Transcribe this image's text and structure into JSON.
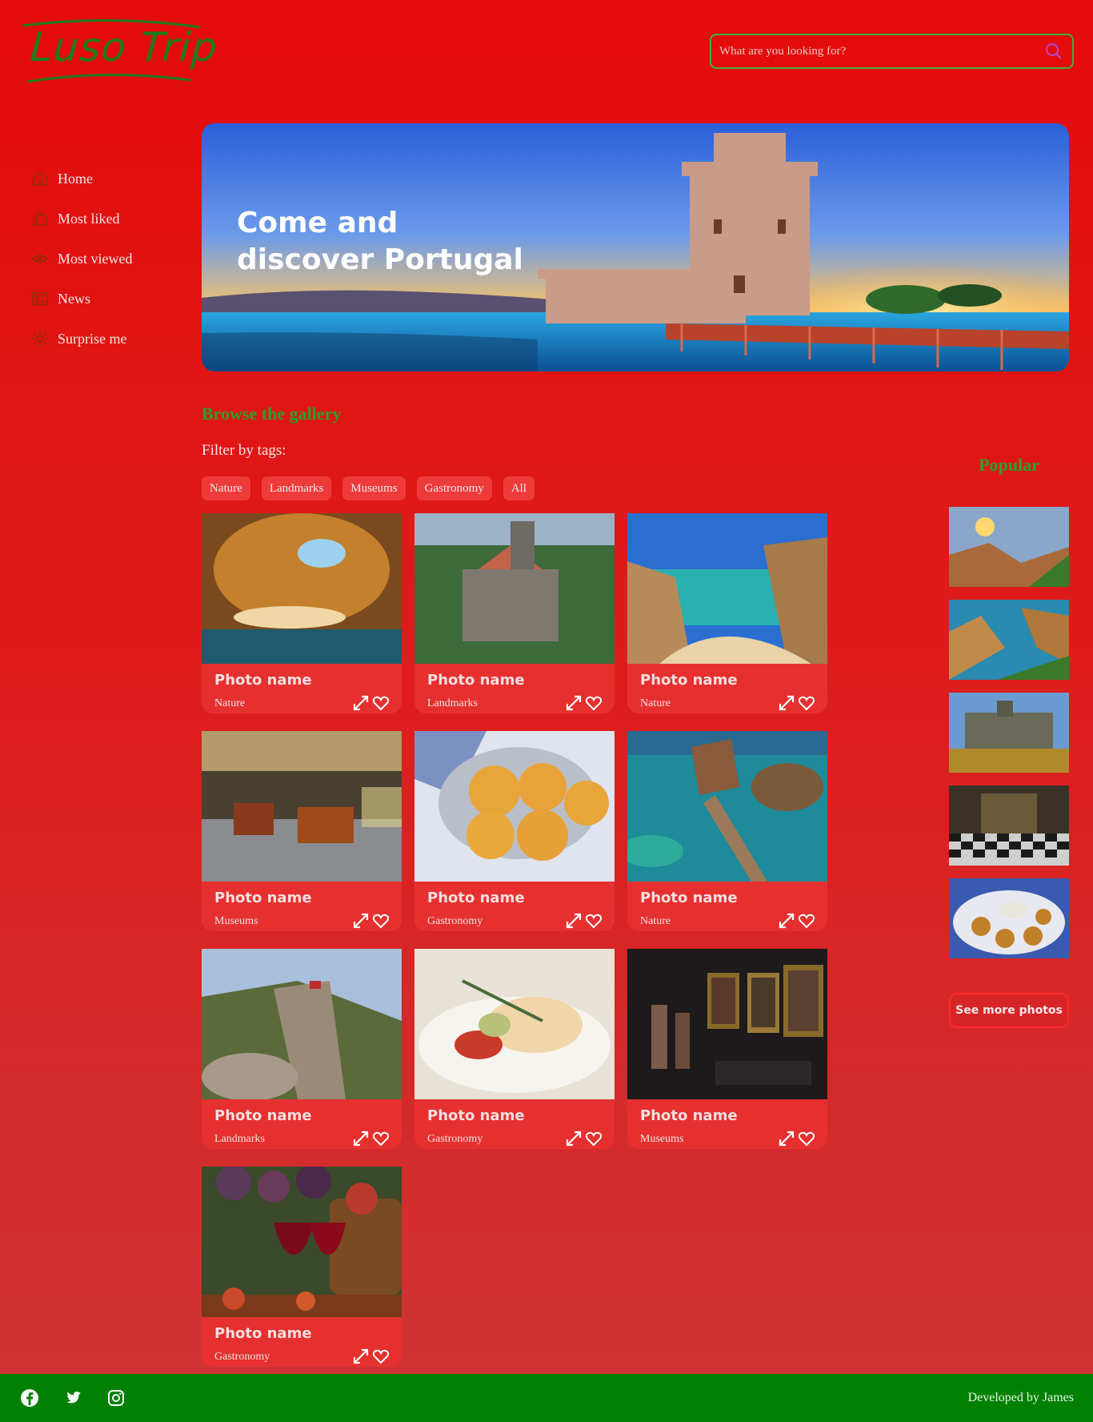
{
  "brand": {
    "logo_text": "Luso Trip",
    "accent_green": "#2aa02a",
    "footer_green": "#008000",
    "background_red": "#e40b0b"
  },
  "search": {
    "placeholder": "What are you looking for?",
    "icon": "search-icon"
  },
  "nav": [
    {
      "label": "Home",
      "icon": "home-icon"
    },
    {
      "label": "Most liked",
      "icon": "thumbs-up-icon"
    },
    {
      "label": "Most viewed",
      "icon": "eye-icon"
    },
    {
      "label": "News",
      "icon": "newspaper-icon"
    },
    {
      "label": "Surprise me",
      "icon": "sun-icon"
    }
  ],
  "hero": {
    "title": "Come and discover Portugal"
  },
  "gallery": {
    "title": "Browse the gallery",
    "filter_label": "Filter by tags:",
    "tags": [
      "Nature",
      "Landmarks",
      "Museums",
      "Gastronomy",
      "All"
    ],
    "cards": [
      {
        "name": "Photo name",
        "tag": "Nature"
      },
      {
        "name": "Photo name",
        "tag": "Landmarks"
      },
      {
        "name": "Photo name",
        "tag": "Nature"
      },
      {
        "name": "Photo name",
        "tag": "Museums"
      },
      {
        "name": "Photo name",
        "tag": "Gastronomy"
      },
      {
        "name": "Photo name",
        "tag": "Nature"
      },
      {
        "name": "Photo name",
        "tag": "Landmarks"
      },
      {
        "name": "Photo name",
        "tag": "Gastronomy"
      },
      {
        "name": "Photo name",
        "tag": "Museums"
      },
      {
        "name": "Photo name",
        "tag": "Gastronomy"
      }
    ]
  },
  "popular": {
    "title": "Popular",
    "see_more": "See more photos"
  },
  "footer": {
    "social": [
      "facebook-icon",
      "twitter-icon",
      "instagram-icon"
    ],
    "credit": "Developed by James"
  }
}
